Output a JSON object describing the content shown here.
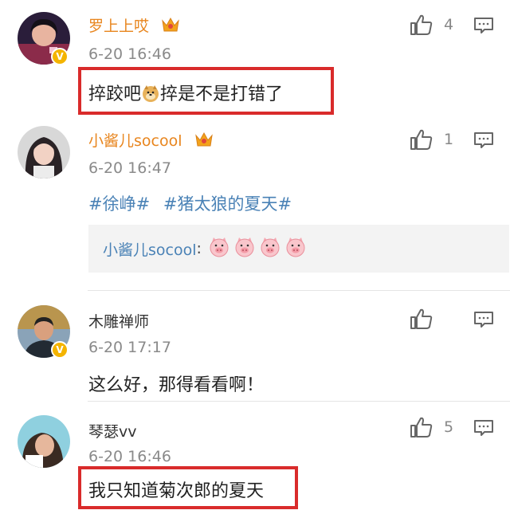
{
  "comments": [
    {
      "username": "罗上上哎",
      "time": "6-20 16:46",
      "text": "捽跤吧",
      "text_after": "捽是不是打错了",
      "emoji": "doge",
      "likes": "4",
      "highlighted": true
    },
    {
      "username": "小酱儿socool",
      "time": "6-20 16:47",
      "hashtags": [
        "#徐峥#",
        "#猪太狼的夏天#"
      ],
      "quote_user": "小酱儿socool",
      "quote_colon": ":",
      "quote_emoji_count": 4,
      "likes": "1"
    },
    {
      "username": "木雕禅师",
      "time": "6-20 17:17",
      "text": "这么好，那得看看啊！",
      "likes": ""
    },
    {
      "username": "琴瑟vv",
      "time": "6-20 16:46",
      "text": "我只知道菊次郎的夏天",
      "likes": "5",
      "highlighted": true
    }
  ],
  "colors": {
    "username_vip": "#e8851d",
    "link": "#4a82b6",
    "highlight_box": "#d92b2b",
    "badge": "#f4b400"
  },
  "icons": {
    "like": "thumbs-up-icon",
    "reply": "comment-icon",
    "vip": "crown-icon",
    "verified": "v-badge-icon",
    "pig": "pig-face-icon",
    "doge": "doge-icon"
  }
}
